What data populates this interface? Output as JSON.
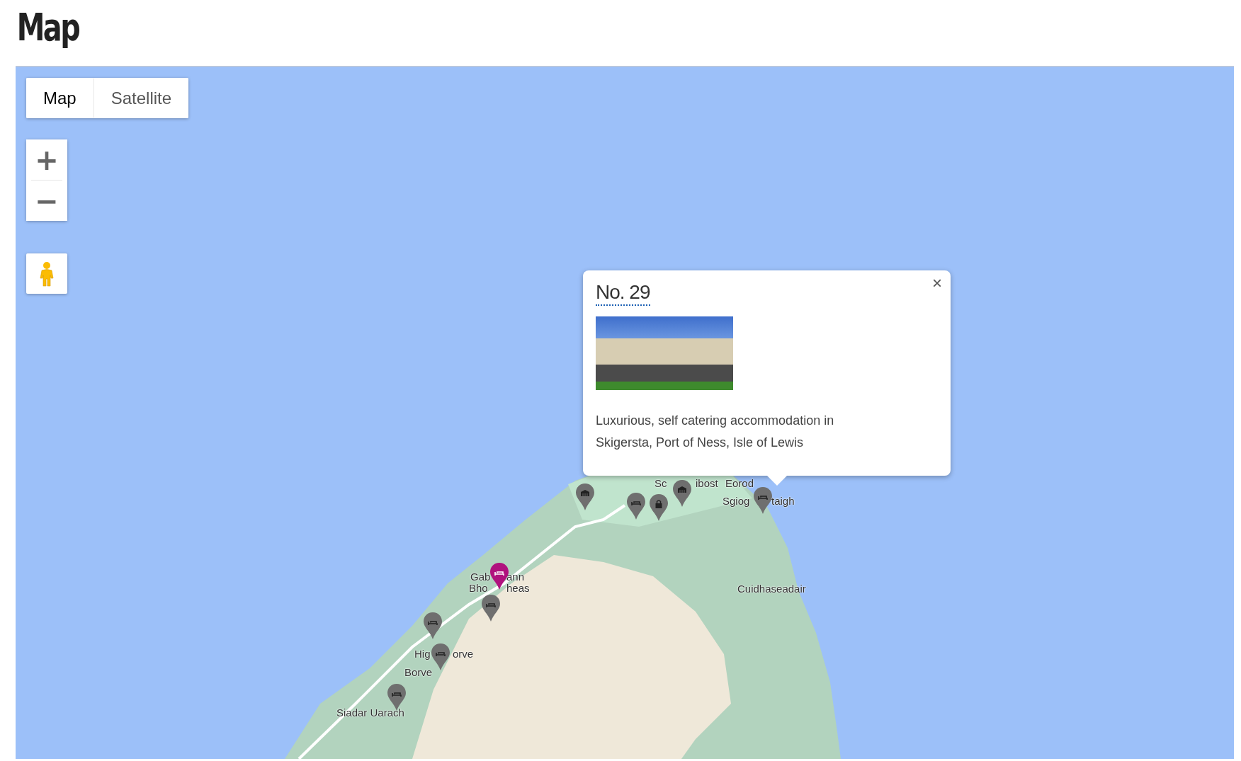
{
  "page_title": "Map",
  "map_type_tabs": [
    {
      "label": "Map",
      "selected": true
    },
    {
      "label": "Satellite",
      "selected": false
    }
  ],
  "zoom_controls": [
    "+",
    "−"
  ],
  "place_labels": [
    "Sc",
    "ibost",
    "Eorod",
    "Sgiog",
    "taigh",
    "Gab",
    "ann",
    "Bho",
    "heas",
    "Cuidhaseadair",
    "Hig",
    "orve",
    "Borve",
    "Siadar Uarach"
  ],
  "pins": [
    {
      "kind": "building",
      "selected": false
    },
    {
      "kind": "bed",
      "selected": false
    },
    {
      "kind": "lock",
      "selected": false
    },
    {
      "kind": "building",
      "selected": false
    },
    {
      "kind": "bed",
      "selected": false
    },
    {
      "kind": "bed",
      "selected": true
    },
    {
      "kind": "bed",
      "selected": false
    },
    {
      "kind": "bed",
      "selected": false
    },
    {
      "kind": "bed",
      "selected": false
    },
    {
      "kind": "bed",
      "selected": false
    }
  ],
  "info_window": {
    "title": "No. 29",
    "close": "×",
    "description": "Luxurious, self catering accommodation in Skigersta, Port of Ness, Isle of Lewis"
  }
}
